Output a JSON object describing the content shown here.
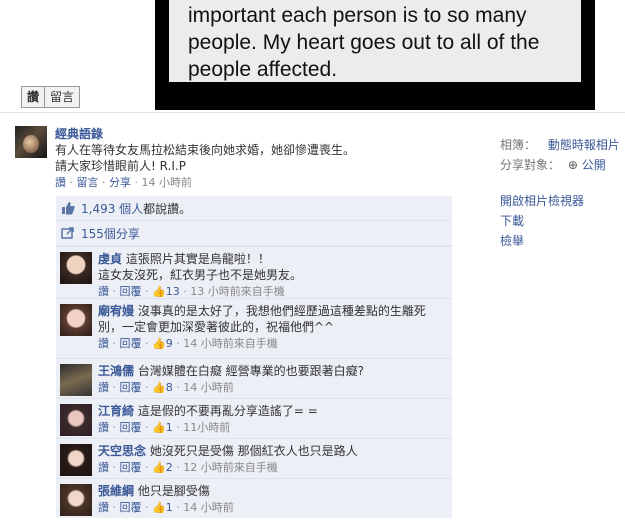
{
  "photo": {
    "lines": [
      "important each person is to so many",
      "people. My heart goes out to all of the",
      "people affected."
    ],
    "like_label": "讚",
    "comment_label": "留言"
  },
  "post": {
    "author": "經典語錄",
    "text_line1": "有人在等待女友馬拉松結束後向她求婚，她卻慘遭喪生。",
    "text_line2": "請大家珍惜眼前人! R.I.P",
    "like": "讚",
    "comment": "留言",
    "share": "分享",
    "time": "14 小時前"
  },
  "ufi": {
    "likes_count": "1,493 個人",
    "likes_suffix": "都說讚。",
    "shares": "155個分享"
  },
  "comments": [
    {
      "name": "虔貞",
      "text": "這張照片其實是烏龍啦！！\n這女友沒死，紅衣男子也不是她男友。",
      "likes": "13",
      "time": "13 小時前來自手機"
    },
    {
      "name": "廟宥嫚",
      "text": "沒事真的是太好了，我想他們經歷過這種差點的生離死別，一定會更加深愛著彼此的，祝福他們^^",
      "likes": "9",
      "time": "14 小時前來自手機"
    },
    {
      "name": "王鴻儒",
      "text": "台灣媒體在白癡 經營專業的也要跟著白癡?",
      "likes": "8",
      "time": "14 小時前"
    },
    {
      "name": "江育綺",
      "text": "這是假的不要再亂分享造謠了= =",
      "likes": "1",
      "time": "11小時前"
    },
    {
      "name": "天空思念",
      "text": "她沒死只是受傷 那個紅衣人也只是路人",
      "likes": "2",
      "time": "12 小時前來自手機"
    },
    {
      "name": "張維綱",
      "text": "他只是腳受傷",
      "likes": "1",
      "time": "14 小時前"
    }
  ],
  "comment_actions": {
    "like": "讚",
    "reply": "回覆"
  },
  "sidebar": {
    "album_label": "相簿：",
    "album_value": "動態時報相片",
    "audience_label": "分享對象：",
    "audience_value": "公開",
    "open_viewer": "開啟相片檢視器",
    "download": "下載",
    "report": "檢舉"
  },
  "colors": {
    "link": "#3b5998",
    "ufi_bg": "#eceff5"
  }
}
